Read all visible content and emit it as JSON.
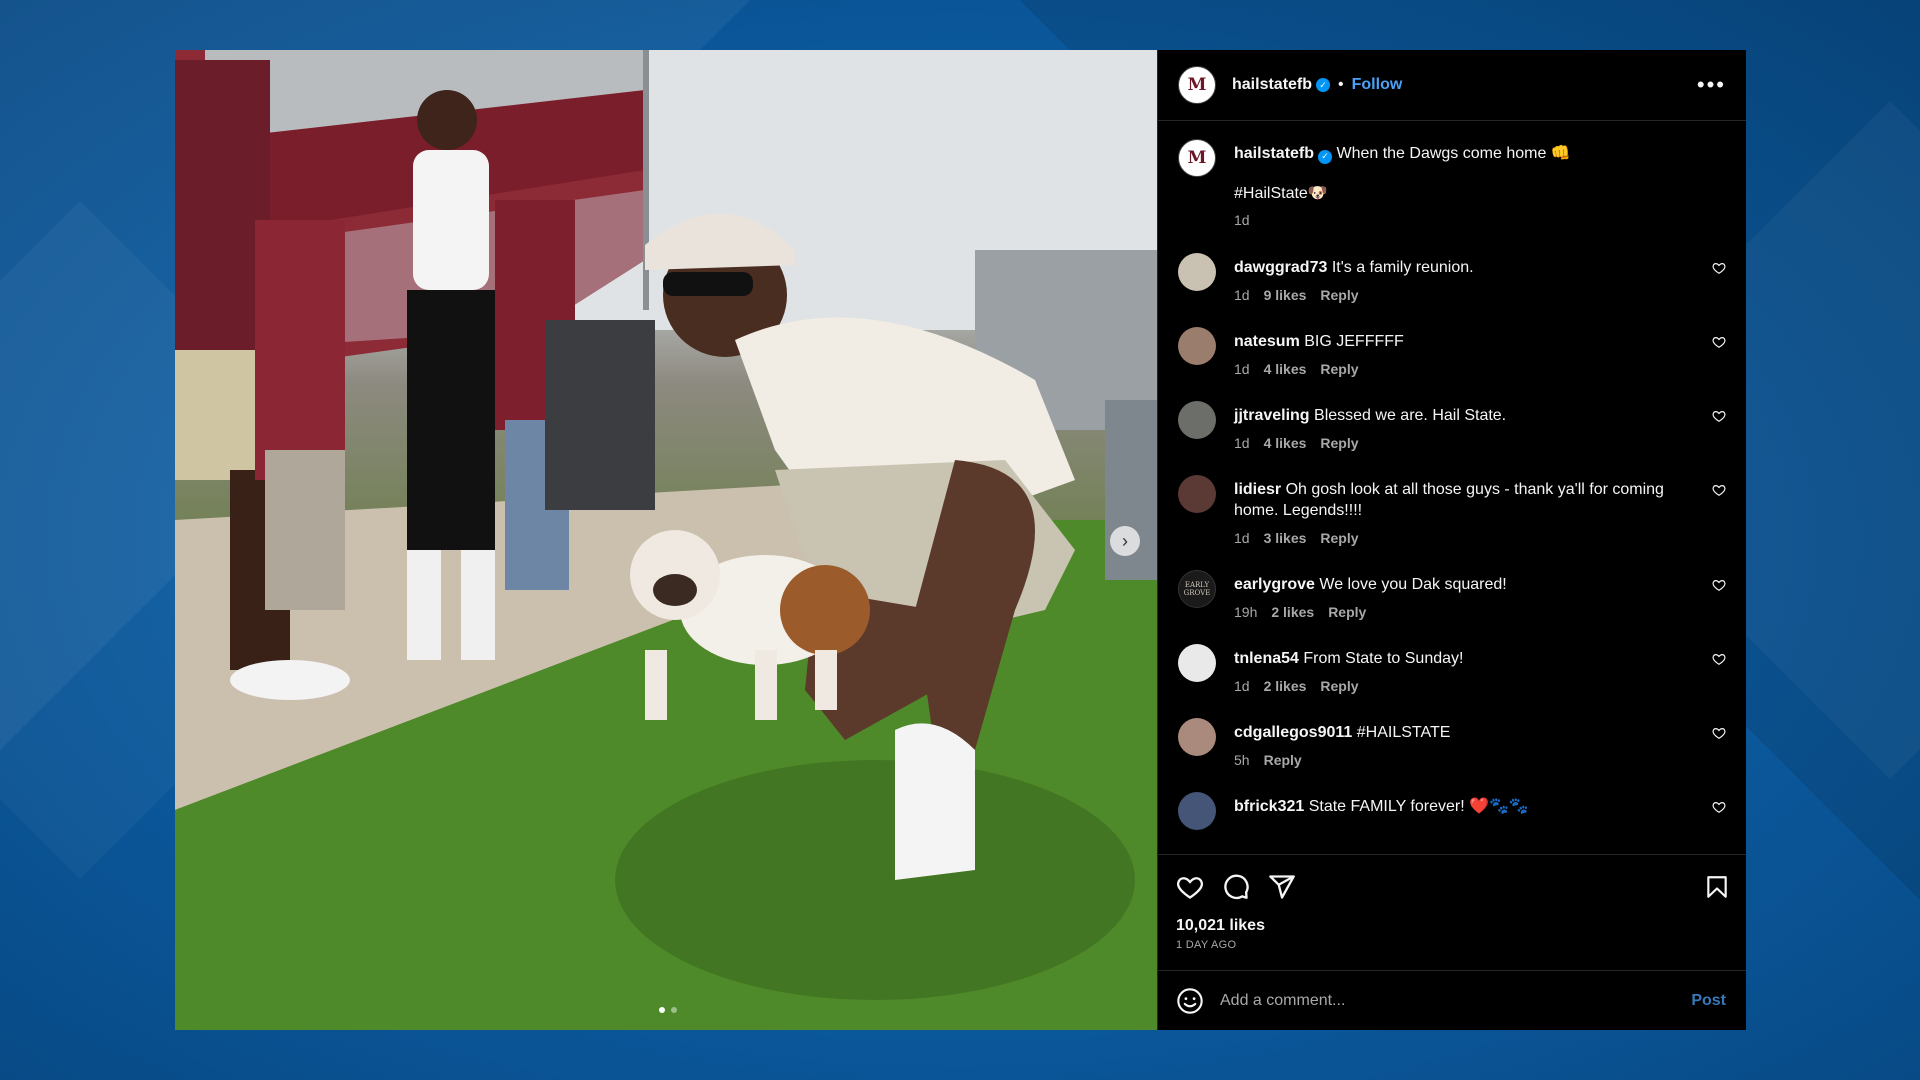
{
  "post": {
    "account": "hailstatefb",
    "avatar_text": "M",
    "follow_label": "Follow",
    "separator": "•",
    "more_label": "•••"
  },
  "caption": {
    "user": "hailstatefb",
    "text": "When the Dawgs come home 👊",
    "hashtag": "#HailState🐶",
    "time": "1d"
  },
  "comments": [
    {
      "user": "dawggrad73",
      "text": "It's a family reunion.",
      "time": "1d",
      "likes": "9 likes",
      "reply": "Reply",
      "avatar_color": "#c9c2b2"
    },
    {
      "user": "natesum",
      "text": "BIG JEFFFFF",
      "time": "1d",
      "likes": "4 likes",
      "reply": "Reply",
      "avatar_color": "#9b7d6d"
    },
    {
      "user": "jjtraveling",
      "text": "Blessed we are. Hail State.",
      "time": "1d",
      "likes": "4 likes",
      "reply": "Reply",
      "avatar_color": "#6c6e6a"
    },
    {
      "user": "lidiesr",
      "text": "Oh gosh look at all those guys - thank ya'll for coming home. Legends!!!!",
      "time": "1d",
      "likes": "3 likes",
      "reply": "Reply",
      "avatar_color": "#5b3a36"
    },
    {
      "user": "earlygrove",
      "text": "We love you Dak squared!",
      "time": "19h",
      "likes": "2 likes",
      "reply": "Reply",
      "avatar_color": "#1a1a1a",
      "avatar_text": "EARLY GROVE"
    },
    {
      "user": "tnlena54",
      "text": "From State to Sunday!",
      "time": "1d",
      "likes": "2 likes",
      "reply": "Reply",
      "avatar_color": "#e9e9e9"
    },
    {
      "user": "cdgallegos9011",
      "text": "#HAILSTATE",
      "time": "5h",
      "likes": "",
      "reply": "Reply",
      "avatar_color": "#a98a7c"
    },
    {
      "user": "bfrick321",
      "text": "State FAMILY forever! ❤️🐾🐾",
      "time": "",
      "likes": "",
      "reply": "",
      "avatar_color": "#445577"
    }
  ],
  "footer": {
    "likes": "10,021 likes",
    "ago": "1 DAY AGO",
    "comment_placeholder": "Add a comment...",
    "post_label": "Post"
  },
  "colors": {
    "background": "#0d5fa6",
    "link": "#4aa1f6",
    "verified": "#0095f6",
    "panel": "#000000"
  },
  "icons": [
    "heart-icon",
    "comment-icon",
    "share-icon",
    "bookmark-icon",
    "emoji-icon",
    "verified-icon",
    "chevron-right-icon",
    "more-icon"
  ]
}
